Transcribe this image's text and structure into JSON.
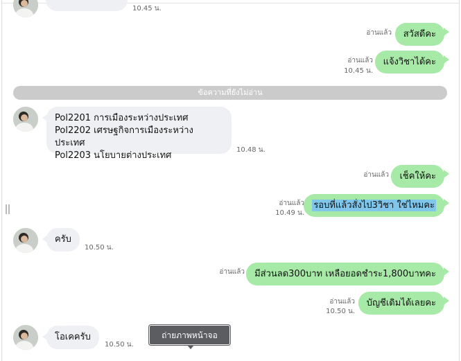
{
  "top_partial": {
    "time": "10.45 น."
  },
  "messages_out_1": [
    {
      "status": "อ่านแล้ว",
      "time": "",
      "text": "สวัสดีคะ"
    },
    {
      "status": "อ่านแล้ว",
      "time": "10.45 น.",
      "text": "แจ้งวิชาได้คะ"
    }
  ],
  "unread_divider": "ข้อความที่ยังไม่อ่าน",
  "incoming_course_list": {
    "lines": [
      "Pol2201 การเมืองระหว่างประเทศ",
      "Pol2202 เศรษฐกิจการเมืองระหว่างประเทศ",
      "Pol2203 นโยบายต่างประเทศ"
    ],
    "time": "10.48 น."
  },
  "messages_out_2": [
    {
      "status": "อ่านแล้ว",
      "time": "",
      "text": "เช็คให้คะ"
    },
    {
      "status": "อ่านแล้ว",
      "time": "10.49 น.",
      "text": "รอบที่แล้วสั่งไป3วิชา ใช่ไหมคะ"
    }
  ],
  "incoming_reply": {
    "text": "ครับ",
    "time": "10.50 น."
  },
  "messages_out_3": [
    {
      "status": "อ่านแล้ว",
      "time": "",
      "text": "มีส่วนลด300บาท เหลือยอดชำระ1,800บาทคะ"
    },
    {
      "status": "อ่านแล้ว",
      "time": "10.50 น.",
      "text": "บัญชีเดิมได้เลยคะ"
    }
  ],
  "incoming_ok": {
    "text": "โอเคครับ",
    "time": "10.50 น."
  },
  "tooltip": "ถ่ายภาพหน้าจอ",
  "colors": {
    "outgoing_bubble": "#a7eaa7",
    "incoming_bubble": "#eef0f3",
    "divider": "#cbcbcb",
    "highlight": "#7fc6ea"
  },
  "icons": {
    "avatar": "user-avatar-photo"
  }
}
